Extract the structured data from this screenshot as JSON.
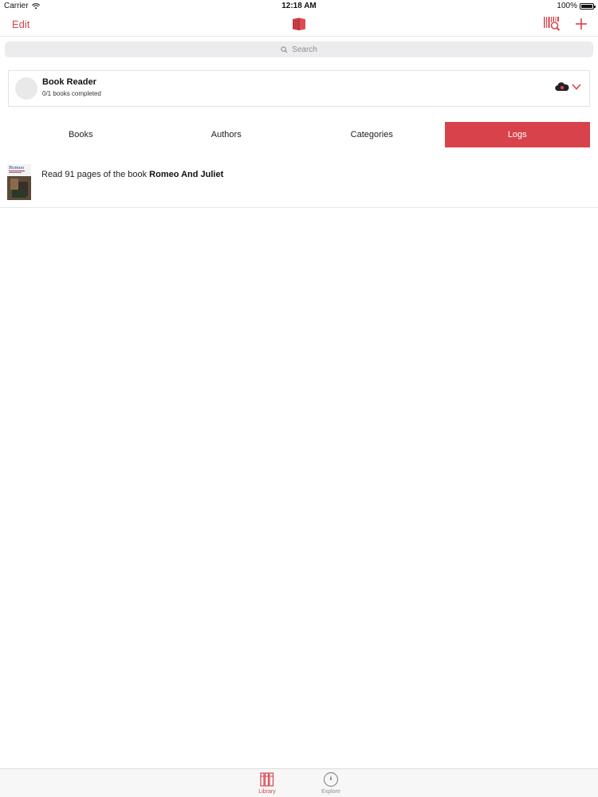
{
  "status_bar": {
    "carrier": "Carrier",
    "time": "12:18 AM",
    "battery": "100%"
  },
  "nav": {
    "edit_label": "Edit",
    "logo_icon": "red-book-icon",
    "scan_icon": "barcode-scan-icon",
    "add_icon": "plus-icon"
  },
  "search": {
    "placeholder": "Search"
  },
  "profile": {
    "name": "Book Reader",
    "progress": "0/1 books completed"
  },
  "tabs": [
    {
      "label": "Books",
      "active": false
    },
    {
      "label": "Authors",
      "active": false
    },
    {
      "label": "Categories",
      "active": false
    },
    {
      "label": "Logs",
      "active": true
    }
  ],
  "logs": [
    {
      "text_prefix": "Read 91 pages of the book ",
      "book_title": "Romeo And Juliet",
      "cover_title": "Romeo"
    }
  ],
  "tab_bar": {
    "library_label": "Library",
    "explore_label": "Explore"
  },
  "colors": {
    "accent": "#d8434b",
    "inactive": "#8e8e93",
    "search_bg": "#ececee"
  }
}
